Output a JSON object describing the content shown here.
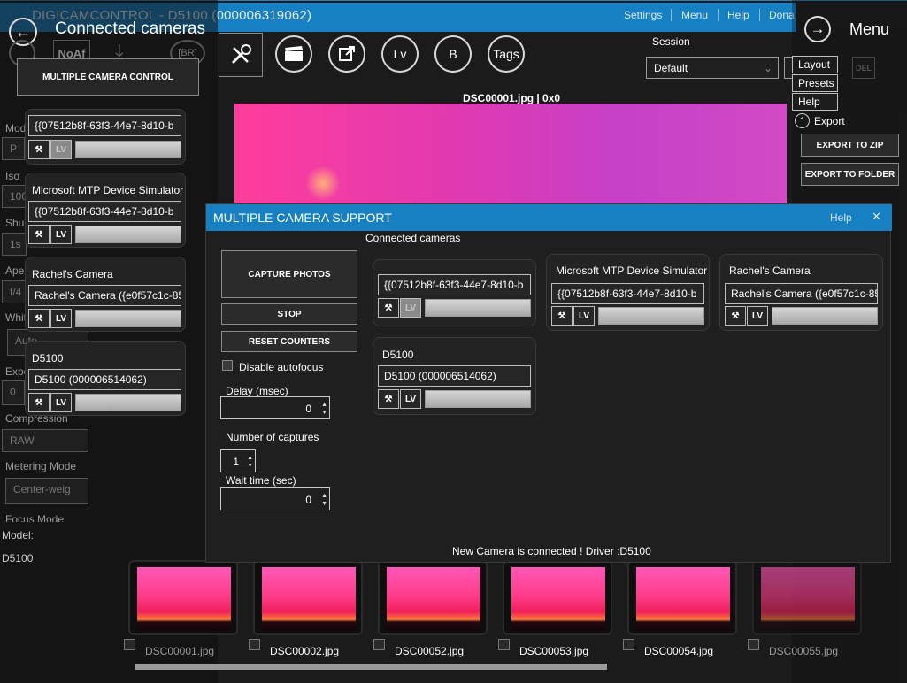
{
  "window": {
    "title": "DIGICAMCONTROL - D5100 (000006319062)",
    "menu": [
      "Settings",
      "Menu",
      "Help",
      "Dona"
    ]
  },
  "left_header": {
    "title": "Connected cameras",
    "multi_button": "MULTIPLE CAMERA CONTROL"
  },
  "bg_toolbar": {
    "naf": "NoAf",
    "brk": "[BR]"
  },
  "toolbar": {
    "lv": "Lv",
    "b": "B",
    "tags": "Tags"
  },
  "session": {
    "label": "Session",
    "value": "Default",
    "del": "DEL"
  },
  "right_menu": {
    "title": "Menu",
    "items": [
      "Layout",
      "Presets",
      "Help"
    ],
    "export_label": "Export",
    "export_zip": "EXPORT TO ZIP",
    "export_folder": "EXPORT TO FOLDER"
  },
  "preview": {
    "caption": "DSC00001.jpg | 0x0"
  },
  "left_cameras": [
    {
      "name": "",
      "field": "{{07512b8f-63f3-44e7-8d10-b"
    },
    {
      "name": "Microsoft MTP Device Simulator",
      "field": "{{07512b8f-63f3-44e7-8d10-b"
    },
    {
      "name": "Rachel's Camera",
      "field": "Rachel's Camera ({e0f57c1c-85"
    },
    {
      "name": "D5100",
      "field": "D5100 (000006514062)"
    }
  ],
  "bg_settings": {
    "mode": "Mod",
    "mode_val": "P",
    "iso": "Iso",
    "iso_val": "100",
    "shutter": "Shu",
    "shutter_val": "1s",
    "aperture": "Aperture",
    "aperture_val": "f/4",
    "white": "White",
    "white_val": "Auto",
    "exposure": "Expo",
    "exposure_val": "0",
    "compression": "Compression",
    "compression_val": "RAW",
    "metering": "Metering Mode",
    "metering_val": "Center-weig",
    "focus": "Focus Mode",
    "model_label": "Model:",
    "model_val": "D5100"
  },
  "dialog": {
    "title": "MULTIPLE CAMERA SUPPORT",
    "help": "Help",
    "close": "✕",
    "connected_label": "Connected cameras",
    "capture": "CAPTURE PHOTOS",
    "stop": "STOP",
    "reset": "RESET COUNTERS",
    "disable_af": "Disable autofocus",
    "delay_label": "Delay (msec)",
    "delay_val": "0",
    "captures_label": "Number of captures",
    "captures_val": "1",
    "wait_label": "Wait time (sec)",
    "wait_val": "0",
    "status": "New Camera is connected ! Driver :D5100",
    "cameras": [
      {
        "name": "",
        "field": "{{07512b8f-63f3-44e7-8d10-b"
      },
      {
        "name": "Microsoft MTP Device Simulator",
        "field": "{{07512b8f-63f3-44e7-8d10-b"
      },
      {
        "name": "Rachel's Camera",
        "field": "Rachel's Camera ({e0f57c1c-85"
      },
      {
        "name": "D5100",
        "field": "D5100 (000006514062)"
      }
    ],
    "lv": "LV"
  },
  "thumbnails": [
    "DSC00001.jpg",
    "DSC00002.jpg",
    "DSC00052.jpg",
    "DSC00053.jpg",
    "DSC00054.jpg",
    "DSC00055.jpg"
  ],
  "colors": {
    "accent": "#1780c2",
    "dialog_bg": "#1f1f1f",
    "preview_pink": "#ff3d9c"
  }
}
